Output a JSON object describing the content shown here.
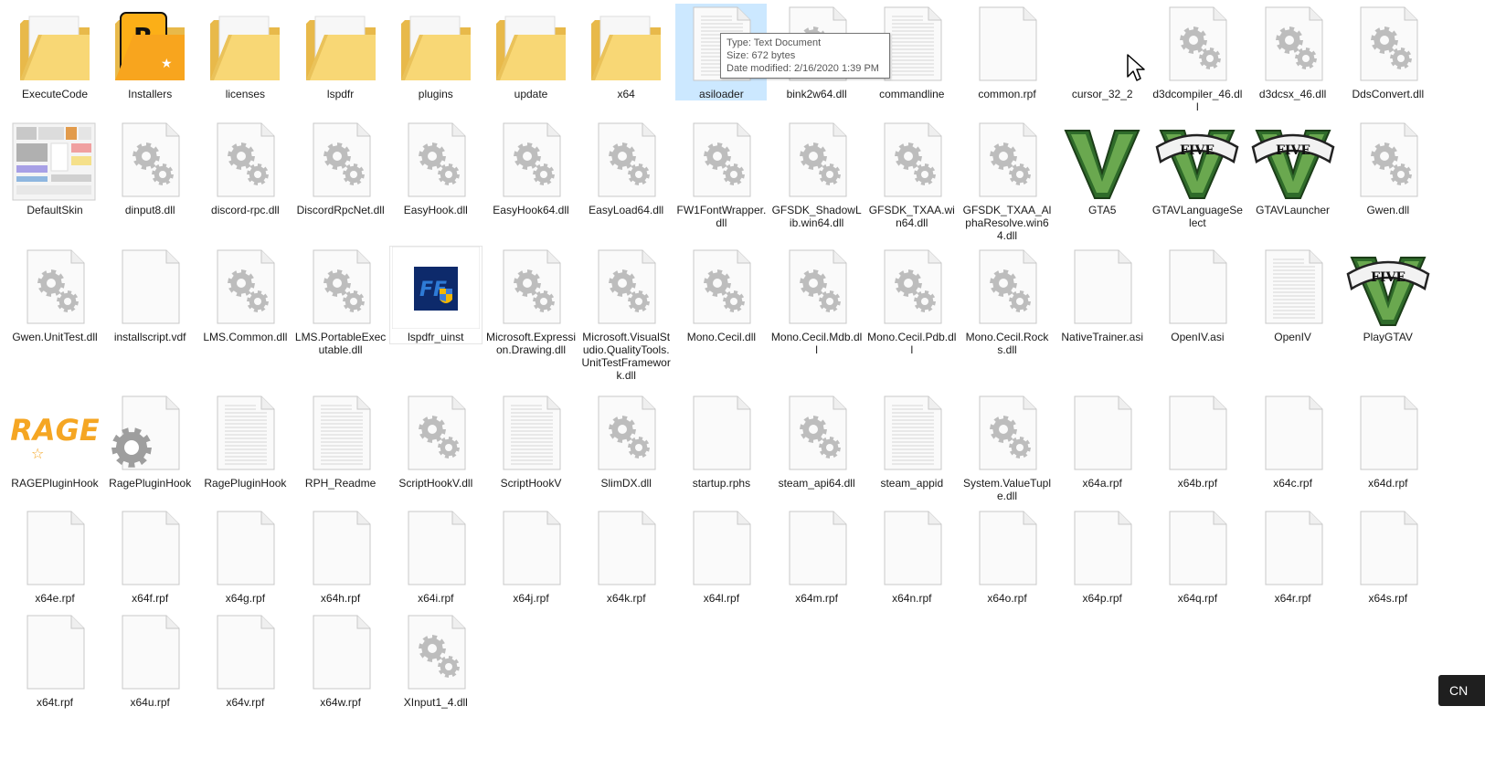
{
  "tooltip": {
    "type": "Type: Text Document",
    "size": "Size: 672 bytes",
    "date": "Date modified: 2/16/2020 1:39 PM"
  },
  "language_indicator": "CN",
  "rows": [
    [
      {
        "name": "ExecuteCode",
        "icon": "folder-icon"
      },
      {
        "name": "Installers",
        "icon": "rockstar-folder-icon"
      },
      {
        "name": "licenses",
        "icon": "folder-icon"
      },
      {
        "name": "lspdfr",
        "icon": "folder-icon"
      },
      {
        "name": "plugins",
        "icon": "folder-gear-icon"
      },
      {
        "name": "update",
        "icon": "folder-icon"
      },
      {
        "name": "x64",
        "icon": "folder-icon"
      },
      {
        "name": "asiloader",
        "icon": "text-file-icon",
        "selected": true
      },
      {
        "name": "bink2w64.dll",
        "icon": "dll-icon"
      },
      {
        "name": "commandline",
        "icon": "text-file-icon"
      },
      {
        "name": "common.rpf",
        "icon": "blank-file-icon"
      },
      {
        "name": "cursor_32_2",
        "icon": "cursor-icon"
      },
      {
        "name": "d3dcompiler_46.dll",
        "icon": "dll-icon"
      },
      {
        "name": "d3dcsx_46.dll",
        "icon": "dll-icon"
      },
      {
        "name": "DdsConvert.dll",
        "icon": "dll-icon"
      }
    ],
    [
      {
        "name": "DefaultSkin",
        "icon": "skin-image-icon"
      },
      {
        "name": "dinput8.dll",
        "icon": "dll-icon"
      },
      {
        "name": "discord-rpc.dll",
        "icon": "dll-icon"
      },
      {
        "name": "DiscordRpcNet.dll",
        "icon": "dll-icon"
      },
      {
        "name": "EasyHook.dll",
        "icon": "dll-icon"
      },
      {
        "name": "EasyHook64.dll",
        "icon": "dll-icon"
      },
      {
        "name": "EasyLoad64.dll",
        "icon": "dll-icon"
      },
      {
        "name": "FW1FontWrapper.dll",
        "icon": "dll-icon"
      },
      {
        "name": "GFSDK_ShadowLib.win64.dll",
        "icon": "dll-icon"
      },
      {
        "name": "GFSDK_TXAA.win64.dll",
        "icon": "dll-icon"
      },
      {
        "name": "GFSDK_TXAA_AlphaResolve.win64.dll",
        "icon": "dll-icon"
      },
      {
        "name": "GTA5",
        "icon": "gta-v-icon"
      },
      {
        "name": "GTAVLanguageSelect",
        "icon": "gta-five-icon"
      },
      {
        "name": "GTAVLauncher",
        "icon": "gta-five-icon"
      },
      {
        "name": "Gwen.dll",
        "icon": "dll-icon"
      }
    ],
    [
      {
        "name": "Gwen.UnitTest.dll",
        "icon": "dll-icon"
      },
      {
        "name": "installscript.vdf",
        "icon": "blank-file-icon"
      },
      {
        "name": "LMS.Common.dll",
        "icon": "dll-icon"
      },
      {
        "name": "LMS.PortableExecutable.dll",
        "icon": "dll-icon"
      },
      {
        "name": "lspdfr_uinst",
        "icon": "lspdfr-uninstall-icon",
        "hovered": true
      },
      {
        "name": "Microsoft.Expression.Drawing.dll",
        "icon": "dll-icon"
      },
      {
        "name": "Microsoft.VisualStudio.QualityTools.UnitTestFramework.dll",
        "icon": "dll-icon"
      },
      {
        "name": "Mono.Cecil.dll",
        "icon": "dll-icon"
      },
      {
        "name": "Mono.Cecil.Mdb.dll",
        "icon": "dll-icon"
      },
      {
        "name": "Mono.Cecil.Pdb.dll",
        "icon": "dll-icon"
      },
      {
        "name": "Mono.Cecil.Rocks.dll",
        "icon": "dll-icon"
      },
      {
        "name": "NativeTrainer.asi",
        "icon": "blank-file-icon"
      },
      {
        "name": "OpenIV.asi",
        "icon": "blank-file-icon"
      },
      {
        "name": "OpenIV",
        "icon": "text-file-icon"
      },
      {
        "name": "PlayGTAV",
        "icon": "gta-five-icon"
      }
    ],
    [
      {
        "name": "RAGEPluginHook",
        "icon": "rage-logo-icon"
      },
      {
        "name": "RagePluginHook",
        "icon": "gear-app-icon"
      },
      {
        "name": "RagePluginHook",
        "icon": "text-file-icon"
      },
      {
        "name": "RPH_Readme",
        "icon": "text-file-icon"
      },
      {
        "name": "ScriptHookV.dll",
        "icon": "dll-icon"
      },
      {
        "name": "ScriptHookV",
        "icon": "text-file-icon"
      },
      {
        "name": "SlimDX.dll",
        "icon": "dll-icon"
      },
      {
        "name": "startup.rphs",
        "icon": "blank-file-icon"
      },
      {
        "name": "steam_api64.dll",
        "icon": "dll-icon"
      },
      {
        "name": "steam_appid",
        "icon": "text-file-icon"
      },
      {
        "name": "System.ValueTuple.dll",
        "icon": "dll-icon"
      },
      {
        "name": "x64a.rpf",
        "icon": "blank-file-icon"
      },
      {
        "name": "x64b.rpf",
        "icon": "blank-file-icon"
      },
      {
        "name": "x64c.rpf",
        "icon": "blank-file-icon"
      },
      {
        "name": "x64d.rpf",
        "icon": "blank-file-icon"
      }
    ],
    [
      {
        "name": "x64e.rpf",
        "icon": "blank-file-icon"
      },
      {
        "name": "x64f.rpf",
        "icon": "blank-file-icon"
      },
      {
        "name": "x64g.rpf",
        "icon": "blank-file-icon"
      },
      {
        "name": "x64h.rpf",
        "icon": "blank-file-icon"
      },
      {
        "name": "x64i.rpf",
        "icon": "blank-file-icon"
      },
      {
        "name": "x64j.rpf",
        "icon": "blank-file-icon"
      },
      {
        "name": "x64k.rpf",
        "icon": "blank-file-icon"
      },
      {
        "name": "x64l.rpf",
        "icon": "blank-file-icon"
      },
      {
        "name": "x64m.rpf",
        "icon": "blank-file-icon"
      },
      {
        "name": "x64n.rpf",
        "icon": "blank-file-icon"
      },
      {
        "name": "x64o.rpf",
        "icon": "blank-file-icon"
      },
      {
        "name": "x64p.rpf",
        "icon": "blank-file-icon"
      },
      {
        "name": "x64q.rpf",
        "icon": "blank-file-icon"
      },
      {
        "name": "x64r.rpf",
        "icon": "blank-file-icon"
      },
      {
        "name": "x64s.rpf",
        "icon": "blank-file-icon"
      }
    ],
    [
      {
        "name": "x64t.rpf",
        "icon": "blank-file-icon"
      },
      {
        "name": "x64u.rpf",
        "icon": "blank-file-icon"
      },
      {
        "name": "x64v.rpf",
        "icon": "blank-file-icon"
      },
      {
        "name": "x64w.rpf",
        "icon": "blank-file-icon"
      },
      {
        "name": "XInput1_4.dll",
        "icon": "dll-icon"
      }
    ]
  ]
}
